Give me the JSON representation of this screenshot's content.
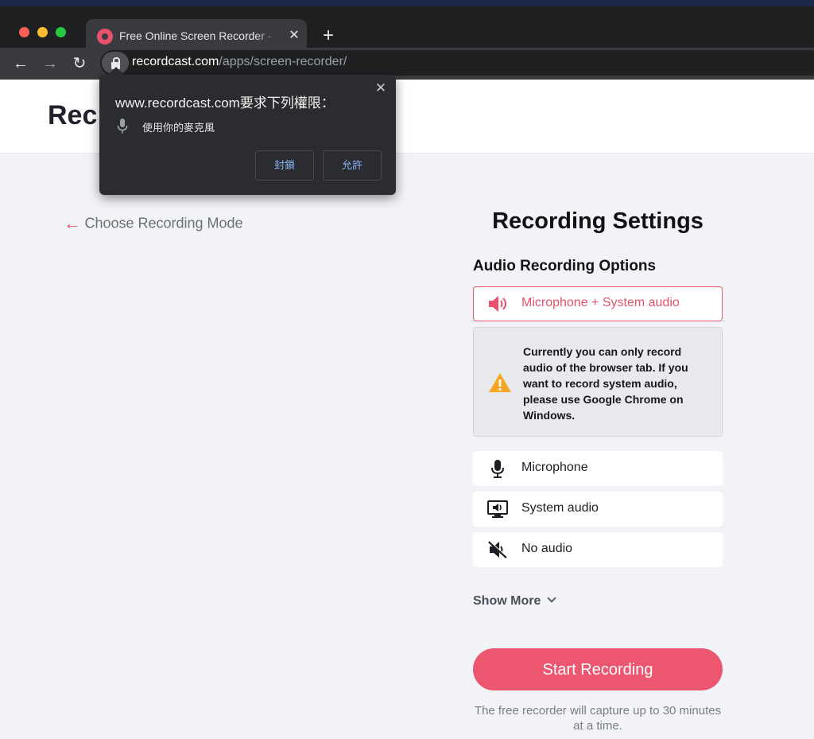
{
  "browser": {
    "tab_title": "Free Online Screen Recorder - ",
    "tab_close": "✕",
    "new_tab": "+",
    "url_host": "recordcast.com",
    "url_path": "/apps/screen-recorder/",
    "back": "←",
    "forward": "→",
    "reload": "↻"
  },
  "permission_popup": {
    "title": "www.recordcast.com要求下列權限：",
    "permission": "使用你的麥克風",
    "block_label": "封鎖",
    "allow_label": "允許",
    "close": "✕"
  },
  "page": {
    "site_title": "Rec",
    "back_arrow": "←",
    "back_link": "Choose Recording Mode",
    "settings_title": "Recording Settings",
    "audio_section_title": "Audio Recording Options",
    "options": [
      {
        "label": "Microphone + System audio",
        "icon": "speaker-icon",
        "selected": true
      },
      {
        "label": "Microphone",
        "icon": "microphone-icon",
        "selected": false
      },
      {
        "label": "System audio",
        "icon": "monitor-speaker-icon",
        "selected": false
      },
      {
        "label": "No audio",
        "icon": "mute-icon",
        "selected": false
      }
    ],
    "warning_text": "Currently you can only record audio of the browser tab. If you want to record system audio, please use Google Chrome on Windows.",
    "show_more": "Show More",
    "start_button": "Start Recording",
    "footnote": "The free recorder will capture up to 30 minutes at a time."
  },
  "colors": {
    "accent": "#ec566f",
    "warning": "#f5a623"
  }
}
